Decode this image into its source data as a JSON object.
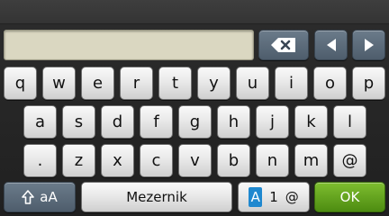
{
  "input": {
    "value": ""
  },
  "rows": [
    [
      "q",
      "w",
      "e",
      "r",
      "t",
      "y",
      "u",
      "i",
      "o",
      "p"
    ],
    [
      "a",
      "s",
      "d",
      "f",
      "g",
      "h",
      "j",
      "k",
      "l"
    ],
    [
      ".",
      "z",
      "x",
      "c",
      "v",
      "b",
      "n",
      "m",
      "@"
    ]
  ],
  "shift_label": "aA",
  "space_label": "Mezernik",
  "mode": {
    "alpha": "A",
    "numeric": "1",
    "symbol": "@"
  },
  "ok_label": "OK",
  "icons": {
    "backspace": "backspace-icon",
    "left": "arrow-left-icon",
    "right": "arrow-right-icon",
    "shift": "shift-up-arrow-icon"
  },
  "colors": {
    "field_bg": "#dad7c1",
    "ok_green": "#5a9a1b",
    "mode_blue": "#1f88cf",
    "control_gray_blue": "#5b6a79"
  }
}
